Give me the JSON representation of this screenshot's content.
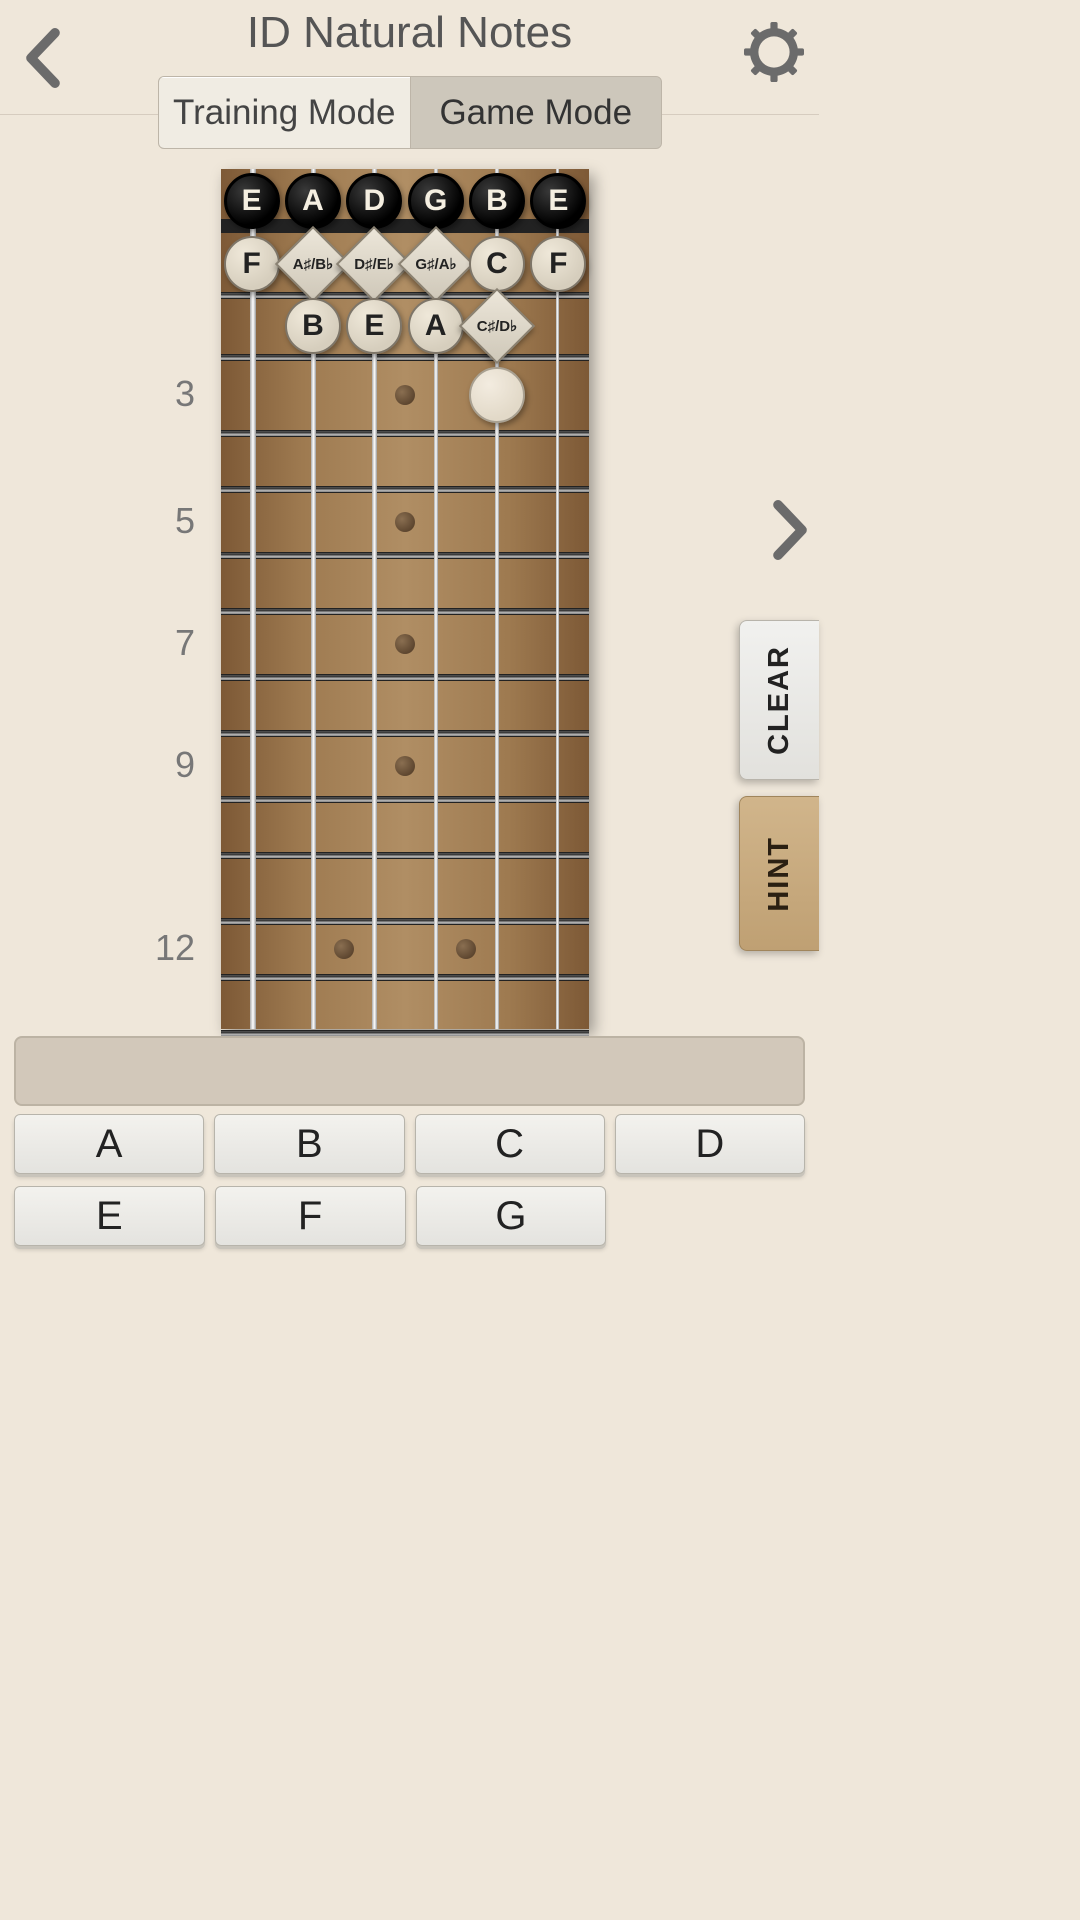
{
  "header": {
    "title": "ID Natural Notes",
    "back_icon": "chevron-left",
    "settings_icon": "gear"
  },
  "modes": {
    "training": "Training Mode",
    "game": "Game Mode",
    "active": "training"
  },
  "fretboard": {
    "open_strings": [
      "E",
      "A",
      "D",
      "G",
      "B",
      "E"
    ],
    "fret_numbers_shown": [
      3,
      5,
      7,
      9,
      12
    ],
    "inlay_single_frets": [
      3,
      5,
      7,
      9
    ],
    "inlay_double_fret": 12,
    "row1": [
      {
        "type": "circle",
        "label": "F"
      },
      {
        "type": "diamond",
        "label": "A♯/B♭"
      },
      {
        "type": "diamond",
        "label": "D♯/E♭"
      },
      {
        "type": "diamond",
        "label": "G♯/A♭"
      },
      {
        "type": "circle",
        "label": "C"
      },
      {
        "type": "circle",
        "label": "F"
      }
    ],
    "row2": [
      {
        "type": "none"
      },
      {
        "type": "circle",
        "label": "B"
      },
      {
        "type": "circle",
        "label": "E"
      },
      {
        "type": "circle",
        "label": "A"
      },
      {
        "type": "diamond",
        "label": "C♯/D♭"
      },
      {
        "type": "none"
      }
    ],
    "question_marker": {
      "fret": 3,
      "string_index": 4
    }
  },
  "side": {
    "next_icon": "chevron-right",
    "clear": "CLEAR",
    "hint": "HINT"
  },
  "answer_bar_text": "",
  "answers_row1": [
    "A",
    "B",
    "C",
    "D"
  ],
  "answers_row2": [
    "E",
    "F",
    "G"
  ]
}
